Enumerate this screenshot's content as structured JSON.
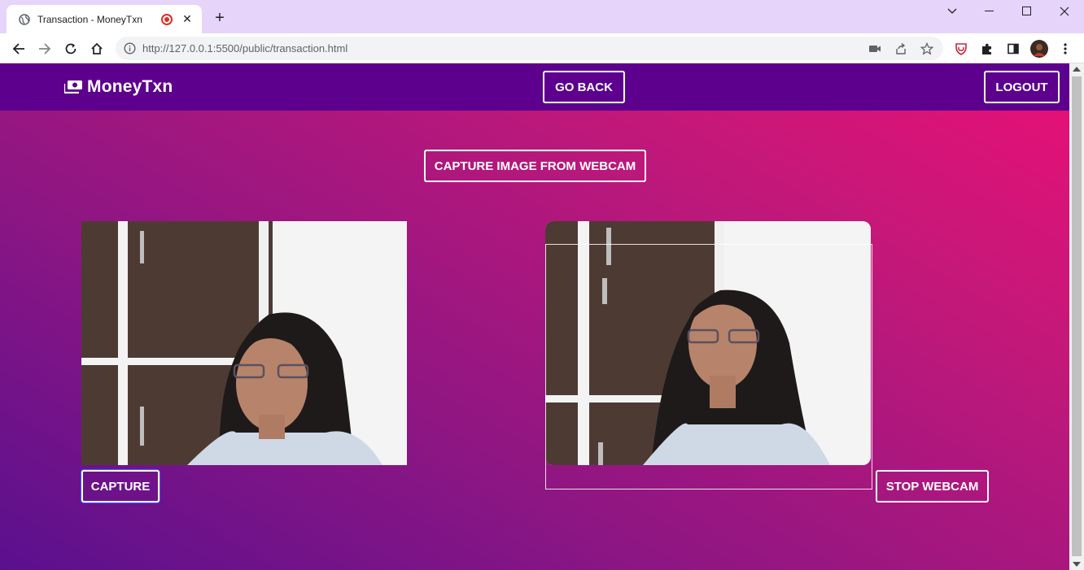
{
  "browser": {
    "tab_title": "Transaction - MoneyTxn",
    "tab_close": "✕",
    "new_tab": "+",
    "url_host": "http://127.0.0.1",
    "url_rest": ":5500/public/transaction.html"
  },
  "navbar": {
    "brand": "MoneyTxn",
    "go_back": "GO BACK",
    "logout": "LOGOUT"
  },
  "main": {
    "capture_from_webcam": "CAPTURE IMAGE FROM WEBCAM",
    "capture": "CAPTURE",
    "stop_webcam": "STOP WEBCAM"
  },
  "colors": {
    "navbar": "#5d008d",
    "gradient_start": "#5a108e",
    "gradient_end": "#e90f76",
    "tabbar": "#e6d4fb"
  }
}
